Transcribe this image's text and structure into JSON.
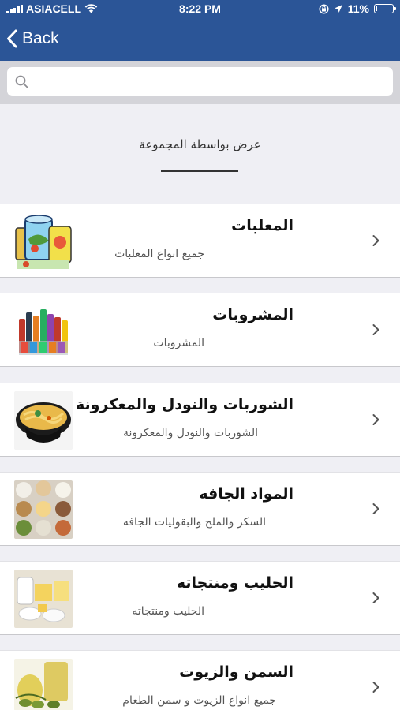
{
  "status_bar": {
    "carrier": "ASIACELL",
    "time": "8:22 PM",
    "battery": "11%",
    "battery_level": 0.11
  },
  "nav": {
    "back_label": "Back"
  },
  "search": {
    "placeholder": ""
  },
  "group_header": {
    "title": "عرض بواسطة المجموعة"
  },
  "categories": [
    {
      "title": "المعلبات",
      "subtitle": "جميع انواع المعلبات",
      "icon": "canned-food-image"
    },
    {
      "title": "المشروبات",
      "subtitle": "المشروبات",
      "icon": "beverages-image"
    },
    {
      "title": "الشوربات والنودل والمعكرونة",
      "subtitle": "الشوربات والنودل والمعكرونة",
      "icon": "noodle-bowl-image"
    },
    {
      "title": "المواد الجافه",
      "subtitle": "السكر والملح والبقوليات الجافه",
      "icon": "dry-goods-image"
    },
    {
      "title": "الحليب ومنتجاته",
      "subtitle": "الحليب ومنتجاته",
      "icon": "dairy-image"
    },
    {
      "title": "السمن والزيوت",
      "subtitle": "جميع انواع الزيوت و سمن الطعام",
      "icon": "oils-image"
    }
  ],
  "colors": {
    "nav_bar": "#2b5597",
    "background": "#efeff4",
    "search_bar": "#d4d4d9"
  }
}
